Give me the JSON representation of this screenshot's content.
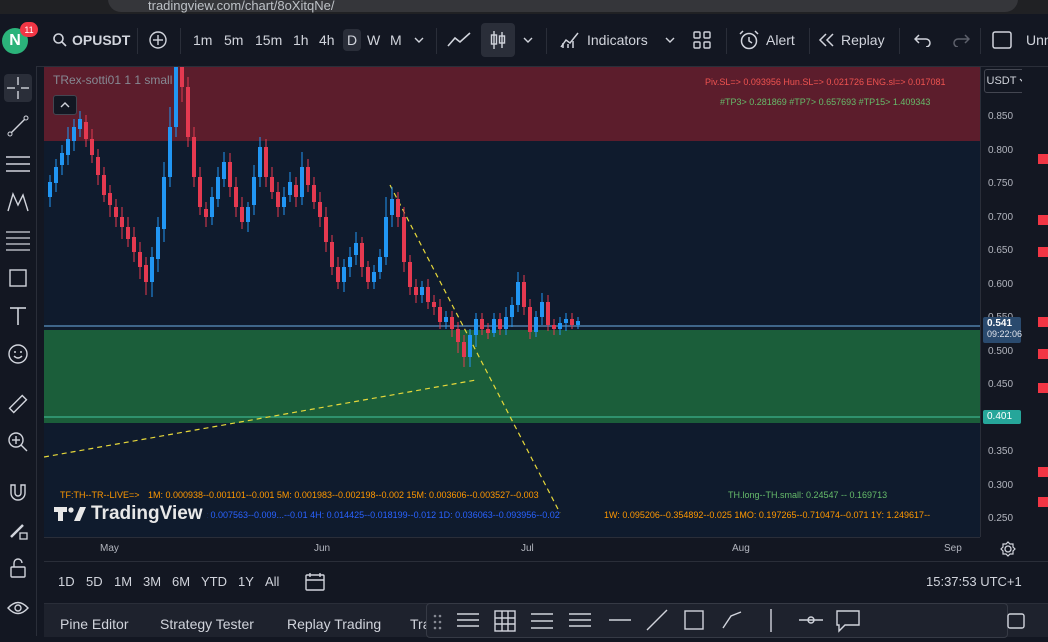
{
  "browser": {
    "url": "tradingview.com/chart/8oXitqNe/"
  },
  "account": {
    "avatar_letter": "N",
    "notifications": "11"
  },
  "toolbar": {
    "symbol": "OPUSDT",
    "timeframes": [
      "1m",
      "5m",
      "15m",
      "1h",
      "4h",
      "D",
      "W",
      "M"
    ],
    "active_timeframe": "D",
    "indicators_label": "Indicators",
    "alert_label": "Alert",
    "replay_label": "Replay",
    "cut_label": "Unn"
  },
  "chart": {
    "legend_title": "TRex-sotti01 1 1 small",
    "currency": "USDT",
    "price_ticks": [
      "0.850",
      "0.800",
      "0.750",
      "0.700",
      "0.650",
      "0.600",
      "0.550",
      "0.500",
      "0.450",
      "0.400",
      "0.350",
      "0.300",
      "0.250"
    ],
    "current_price": "0.541",
    "countdown": "09:22:06",
    "line_price": "0.401",
    "time_ticks": [
      "May",
      "Jun",
      "Jul",
      "Aug",
      "Sep"
    ],
    "top_info_1": "Piv.SL=> 0.093956  Hun.SL=> 0.021726  ENG.sl=> 0.017081",
    "top_info_2": "#TP3> 0.281869  #TP7> 0.657693  #TP15> 1.409343",
    "bottom_info_1a": "TF:TH--TR--LIVE=>",
    "bottom_info_1b": "1M: 0.000938--0.001101--0.001    5M: 0.001983--0.002198--0.002    15M: 0.003606--0.003527--0.003",
    "bottom_info_1c": "TH.long--TH.small: 0.24547 -- 0.169713",
    "bottom_info_2a": "1H: 0.007563--0.009...--0.01    4H: 0.014425--0.018199--0.012    1D: 0.036063--0.093956--0.02",
    "bottom_info_2b": "1W: 0.095206--0.354892--0.025    1MO: 0.197265--0.710474--0.071    1Y: 1.249617--",
    "logo_text": "TradingView",
    "colors": {
      "up": "#2196f3",
      "down": "#e53950",
      "zone_green": "#1b5e3a",
      "zone_red": "#5c1d2c",
      "yellow": "#e6d83a"
    }
  },
  "range_bar": {
    "ranges": [
      "1D",
      "5D",
      "1M",
      "3M",
      "6M",
      "YTD",
      "1Y",
      "All"
    ],
    "clock": "15:37:53 UTC+1"
  },
  "bottom_panel": {
    "tabs": [
      "Pine Editor",
      "Strategy Tester",
      "Replay Trading",
      "Tra"
    ]
  }
}
